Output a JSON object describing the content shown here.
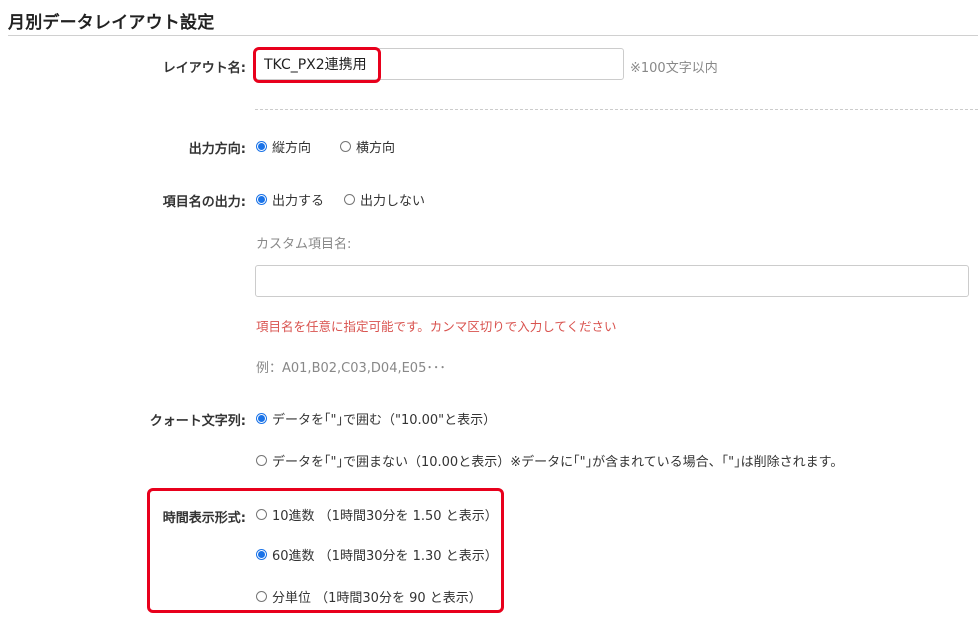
{
  "page_title": "月別データレイアウト設定",
  "layout_name": {
    "label": "レイアウト名:",
    "value": "TKC_PX2連携用",
    "hint": "※100文字以内"
  },
  "output_direction": {
    "label": "出力方向:",
    "options": [
      {
        "label": "縦方向",
        "checked": true
      },
      {
        "label": "横方向",
        "checked": false
      }
    ]
  },
  "item_name_output": {
    "label": "項目名の出力:",
    "options": [
      {
        "label": "出力する",
        "checked": true
      },
      {
        "label": "出力しない",
        "checked": false
      }
    ],
    "custom_label": "カスタム項目名:",
    "custom_value": "",
    "note": "項目名を任意に指定可能です。カンマ区切りで入力してください",
    "example": "例：A01,B02,C03,D04,E05･･･"
  },
  "quote_string": {
    "label": "クォート文字列:",
    "options": [
      {
        "label": "データを｢\"｣で囲む（\"10.00\"と表示）",
        "checked": true
      },
      {
        "label": "データを｢\"｣で囲まない（10.00と表示）※データに｢\"｣が含まれている場合、｢\"｣は削除されます。",
        "checked": false
      }
    ]
  },
  "time_format": {
    "label": "時間表示形式:",
    "options": [
      {
        "label": "10進数 （1時間30分を 1.50 と表示）",
        "checked": false
      },
      {
        "label": "60進数 （1時間30分を 1.30 と表示）",
        "checked": true
      },
      {
        "label": "分単位 （1時間30分を 90 と表示）",
        "checked": false
      }
    ]
  },
  "colors": {
    "highlight": "#e8001c",
    "radio_checked": "#1a73e8",
    "warning_text": "#d9534f"
  }
}
